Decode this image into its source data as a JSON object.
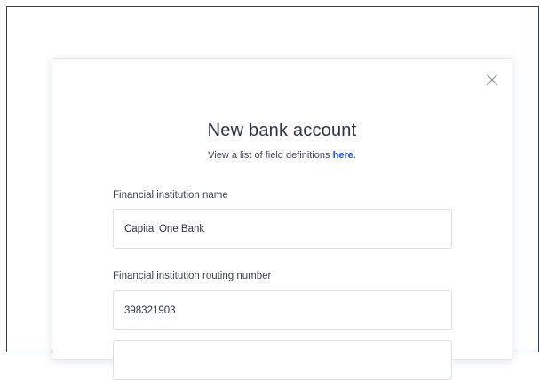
{
  "modal": {
    "title": "New bank account",
    "subtitle_prefix": "View a list of field definitions ",
    "subtitle_link": "here",
    "subtitle_suffix": "."
  },
  "fields": [
    {
      "label": "Financial institution name",
      "value": "Capital One Bank"
    },
    {
      "label": "Financial institution routing number",
      "value": "398321903"
    },
    {
      "label": "",
      "value": ""
    }
  ],
  "icons": {
    "close": "close-icon"
  },
  "colors": {
    "link": "#1f4fc9",
    "frame_border": "#2f3e55"
  }
}
